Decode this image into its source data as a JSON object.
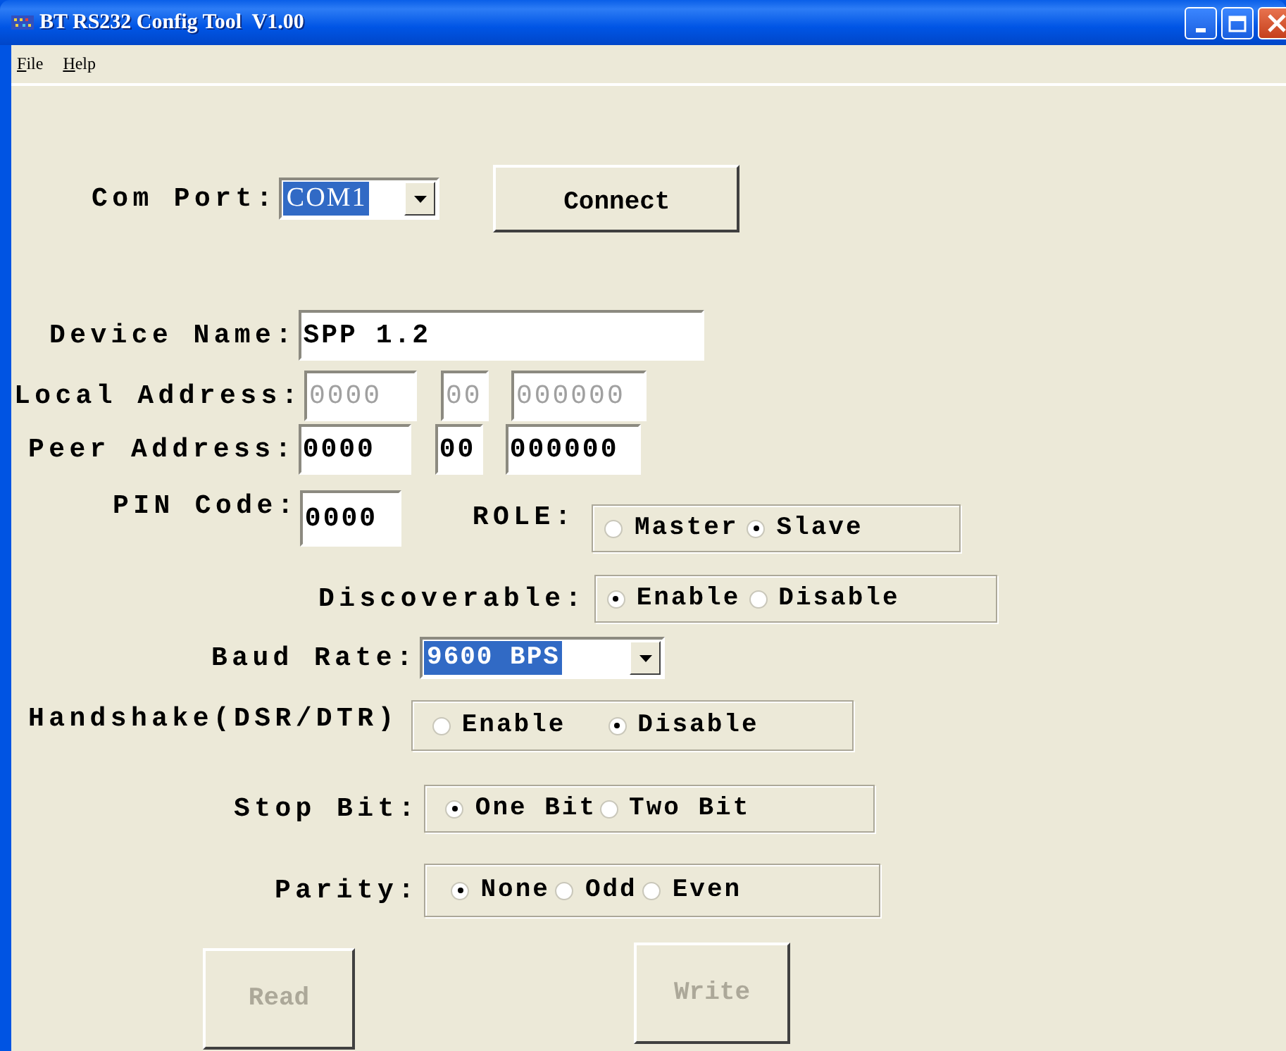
{
  "window": {
    "title": "BT RS232 Config Tool  V1.00"
  },
  "menu": [
    {
      "label": "File"
    },
    {
      "label": "Help"
    }
  ],
  "com_port": {
    "label": "Com Port:",
    "value": "COM1",
    "button": "Connect"
  },
  "device_name": {
    "label": "Device Name:",
    "value": "SPP 1.2"
  },
  "local_address": {
    "label": "Local Address:",
    "parts": [
      "0000",
      "00",
      "000000"
    ],
    "disabled": true
  },
  "peer_address": {
    "label": "Peer Address:",
    "parts": [
      "0000",
      "00",
      "000000"
    ],
    "disabled": false
  },
  "pin_code": {
    "label": "PIN Code:",
    "value": "0000"
  },
  "role": {
    "label": "ROLE:",
    "options": [
      {
        "label": "Master",
        "selected": false
      },
      {
        "label": "Slave",
        "selected": true
      }
    ]
  },
  "discoverable": {
    "label": "Discoverable:",
    "options": [
      {
        "label": "Enable",
        "selected": true
      },
      {
        "label": "Disable",
        "selected": false
      }
    ]
  },
  "baud_rate": {
    "label": "Baud Rate:",
    "value": "9600 BPS"
  },
  "handshake": {
    "label": "Handshake(DSR/DTR)",
    "options": [
      {
        "label": "Enable",
        "selected": false
      },
      {
        "label": "Disable",
        "selected": true
      }
    ]
  },
  "stop_bit": {
    "label": "Stop Bit:",
    "options": [
      {
        "label": "One Bit",
        "selected": true
      },
      {
        "label": "Two Bit",
        "selected": false
      }
    ]
  },
  "parity": {
    "label": "Parity:",
    "options": [
      {
        "label": "None",
        "selected": true
      },
      {
        "label": "Odd",
        "selected": false
      },
      {
        "label": "Even",
        "selected": false
      }
    ]
  },
  "buttons": [
    {
      "label": "Read",
      "disabled": true
    },
    {
      "label": "Write",
      "disabled": true
    }
  ]
}
